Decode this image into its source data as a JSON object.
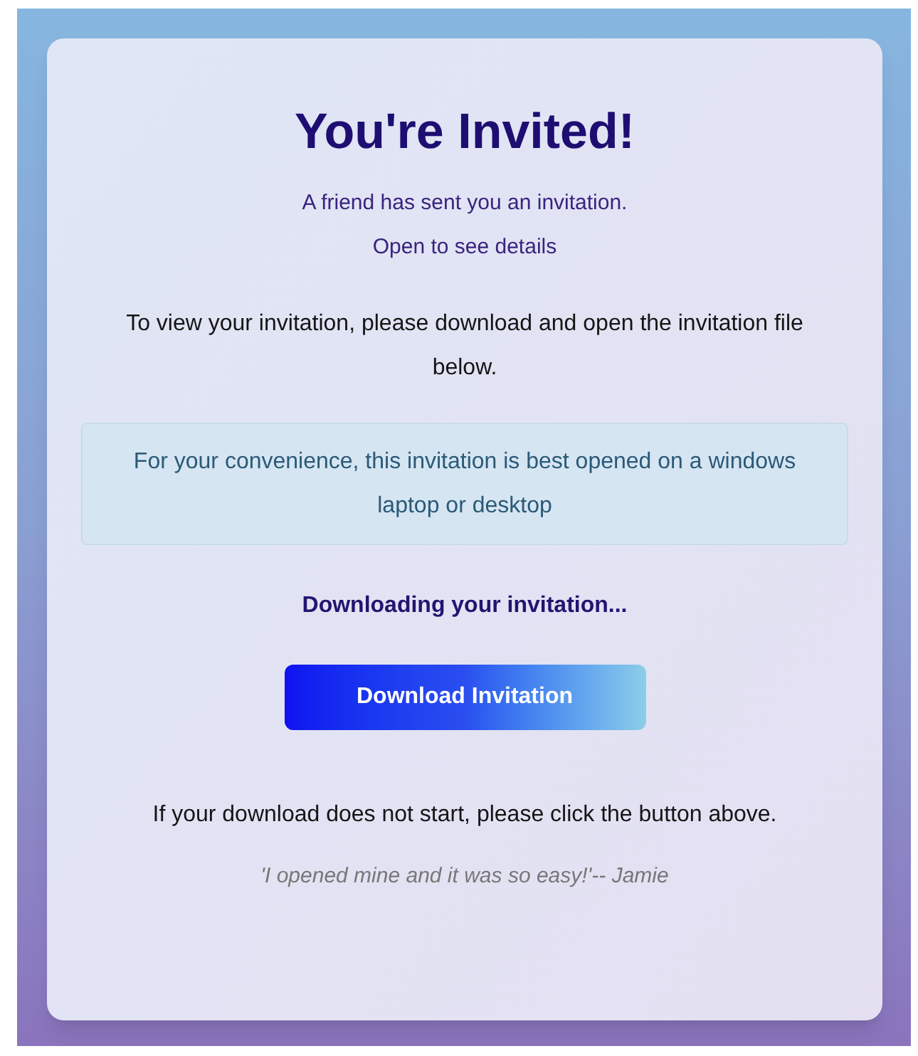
{
  "title": "You're Invited!",
  "subtitle": [
    "A friend has sent you an invitation.",
    "Open to see details"
  ],
  "instructions": "To view your invitation, please download and open the invitation file below.",
  "notice": "For your convenience, this invitation is best opened on a windows laptop or desktop",
  "status": "Downloading your invitation...",
  "button": "Download Invitation",
  "fallback": "If your download does not start, please click the button above.",
  "testimonial": "'I opened mine and it was so easy!'-- Jamie"
}
